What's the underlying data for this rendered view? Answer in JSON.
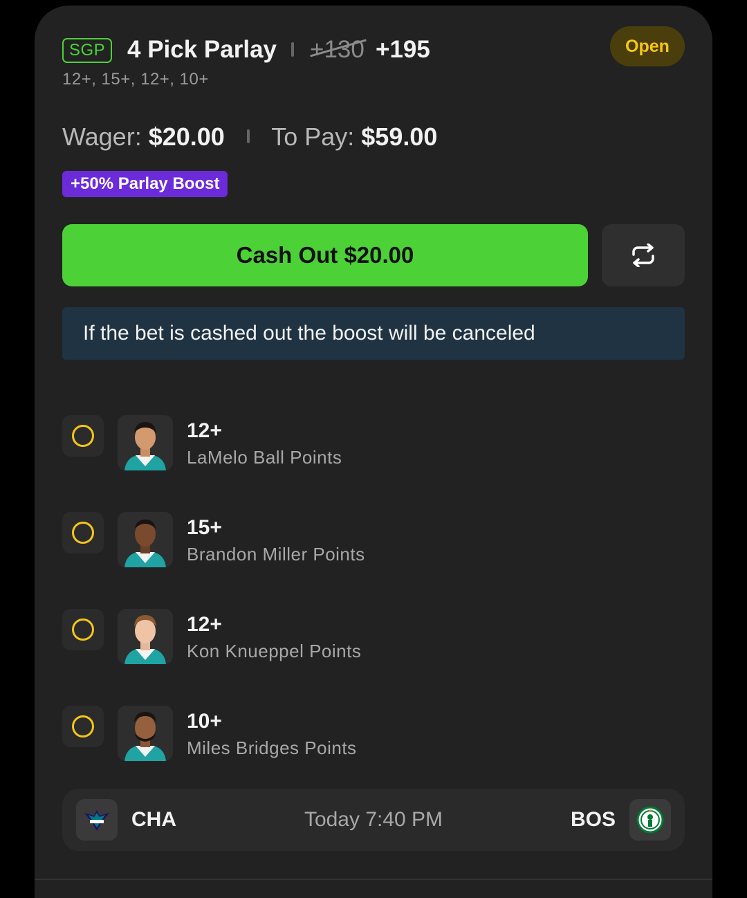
{
  "bet": {
    "tag": "SGP",
    "title": "4 Pick Parlay",
    "old_odds": "+130",
    "new_odds": "+195",
    "subtitle": "12+, 15+, 12+, 10+",
    "status": "Open"
  },
  "wager": {
    "wager_label": "Wager:",
    "wager_value": "$20.00",
    "topay_label": "To Pay:",
    "topay_value": "$59.00"
  },
  "boost_label": "+50% Parlay Boost",
  "cashout_label": "Cash Out $20.00",
  "notice": "If the bet is cashed out the boost will be canceled",
  "legs": [
    {
      "line": "12+",
      "market": "LaMelo Ball Points"
    },
    {
      "line": "15+",
      "market": "Brandon Miller Points"
    },
    {
      "line": "12+",
      "market": "Kon Knueppel Points"
    },
    {
      "line": "10+",
      "market": "Miles Bridges Points"
    }
  ],
  "game": {
    "home": "CHA",
    "time": "Today 7:40 PM",
    "away": "BOS"
  },
  "colors": {
    "accent_green": "#4cd137",
    "status_yellow": "#f5c518",
    "boost_purple": "#6c2bd9",
    "notice_bg": "#1f3343"
  }
}
